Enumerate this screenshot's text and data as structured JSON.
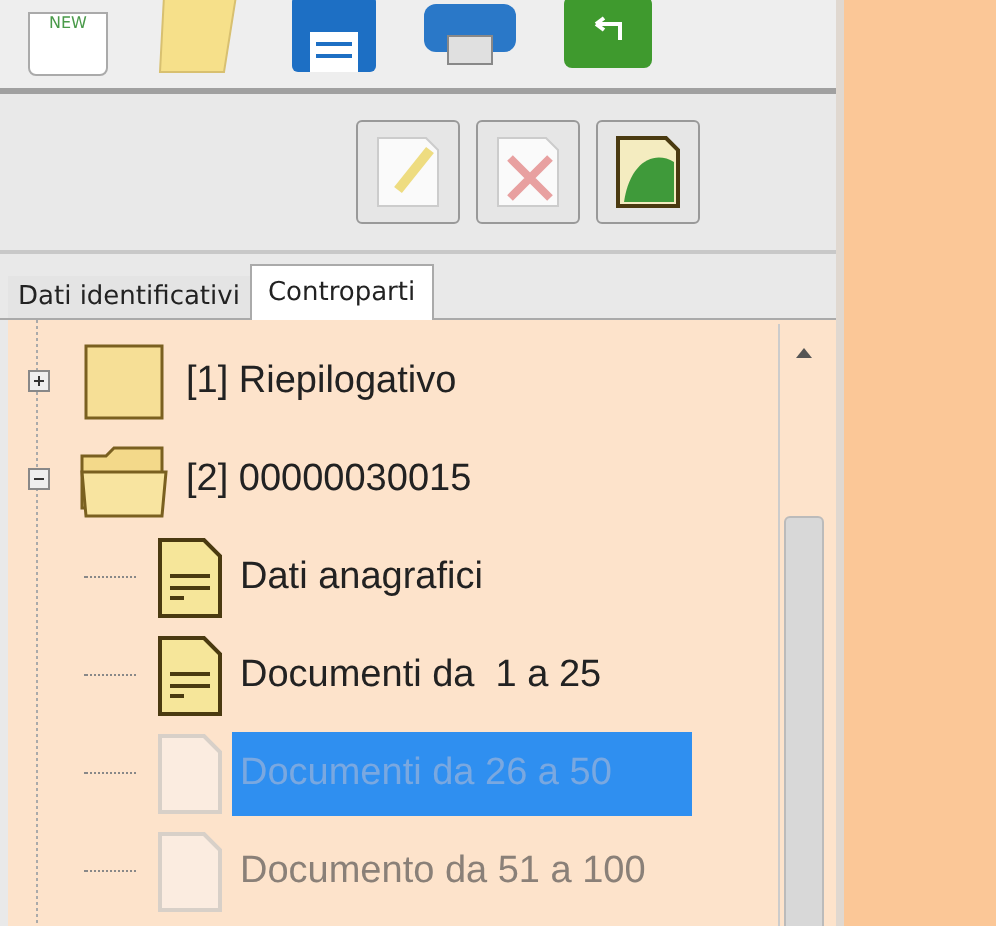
{
  "toolbar": {
    "new_label": "NEW"
  },
  "tabs": [
    {
      "label": "Dati identificativi",
      "selected": false
    },
    {
      "label": "Controparti",
      "selected": true
    }
  ],
  "tree": [
    {
      "label": "[1] Riepilogativo",
      "kind": "folder",
      "expanded": false
    },
    {
      "label": "[2] 00000030015",
      "kind": "folder",
      "expanded": true,
      "children": [
        {
          "label": "Dati anagrafici",
          "disabled": false,
          "selected": false
        },
        {
          "label": "Documenti da  1 a 25",
          "disabled": false,
          "selected": false
        },
        {
          "label": "Documenti da 26 a 50",
          "disabled": true,
          "selected": true
        },
        {
          "label": "Documento da 51 a 100",
          "disabled": true,
          "selected": false
        }
      ]
    }
  ]
}
